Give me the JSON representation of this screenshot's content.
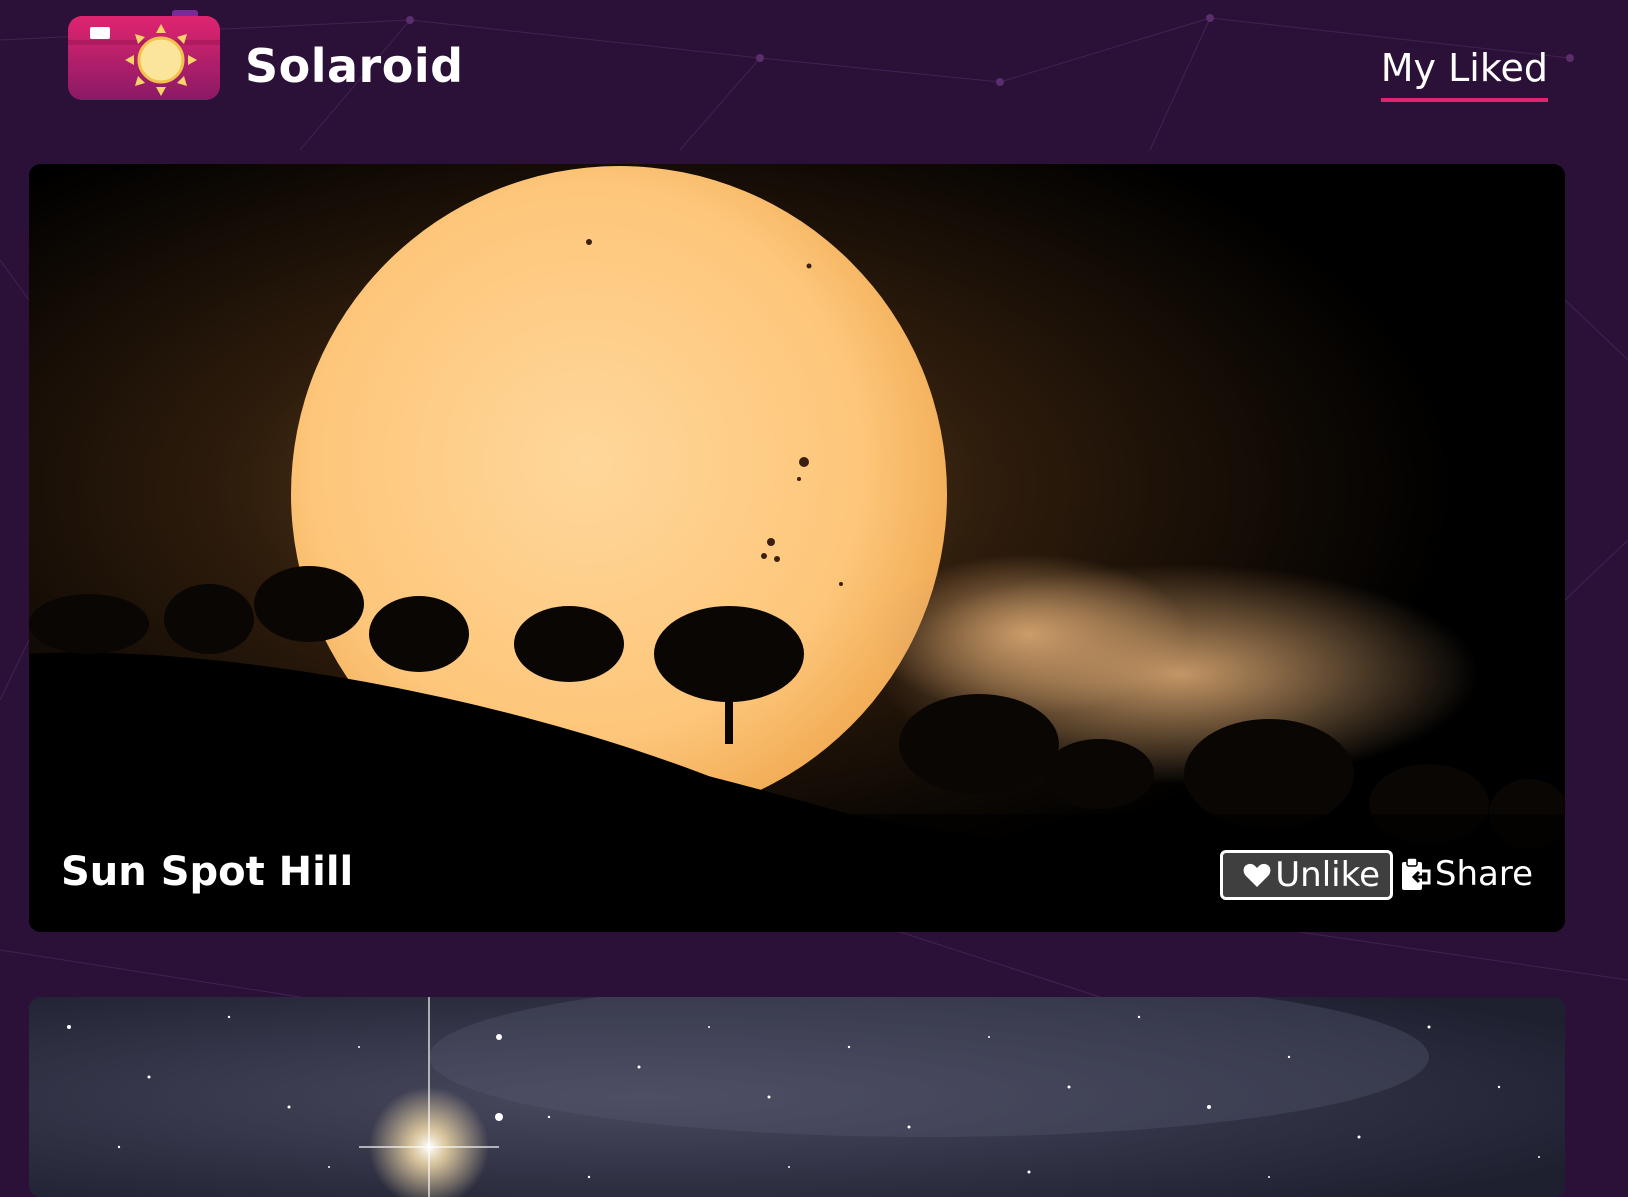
{
  "app": {
    "brand_name": "Solaroid",
    "logo_icon": "camera-sun-logo-icon"
  },
  "nav": {
    "liked_label": "My Liked"
  },
  "colors": {
    "background": "#2b1138",
    "accent": "#e0246f",
    "card_background": "#000000"
  },
  "cards": [
    {
      "title": "Sun Spot Hill",
      "unlike_label": "Unlike",
      "unlike_icon": "heart-icon",
      "share_label": "Share",
      "share_icon": "clipboard-share-icon"
    },
    {
      "title": "",
      "photo": "starfield-photo"
    }
  ]
}
